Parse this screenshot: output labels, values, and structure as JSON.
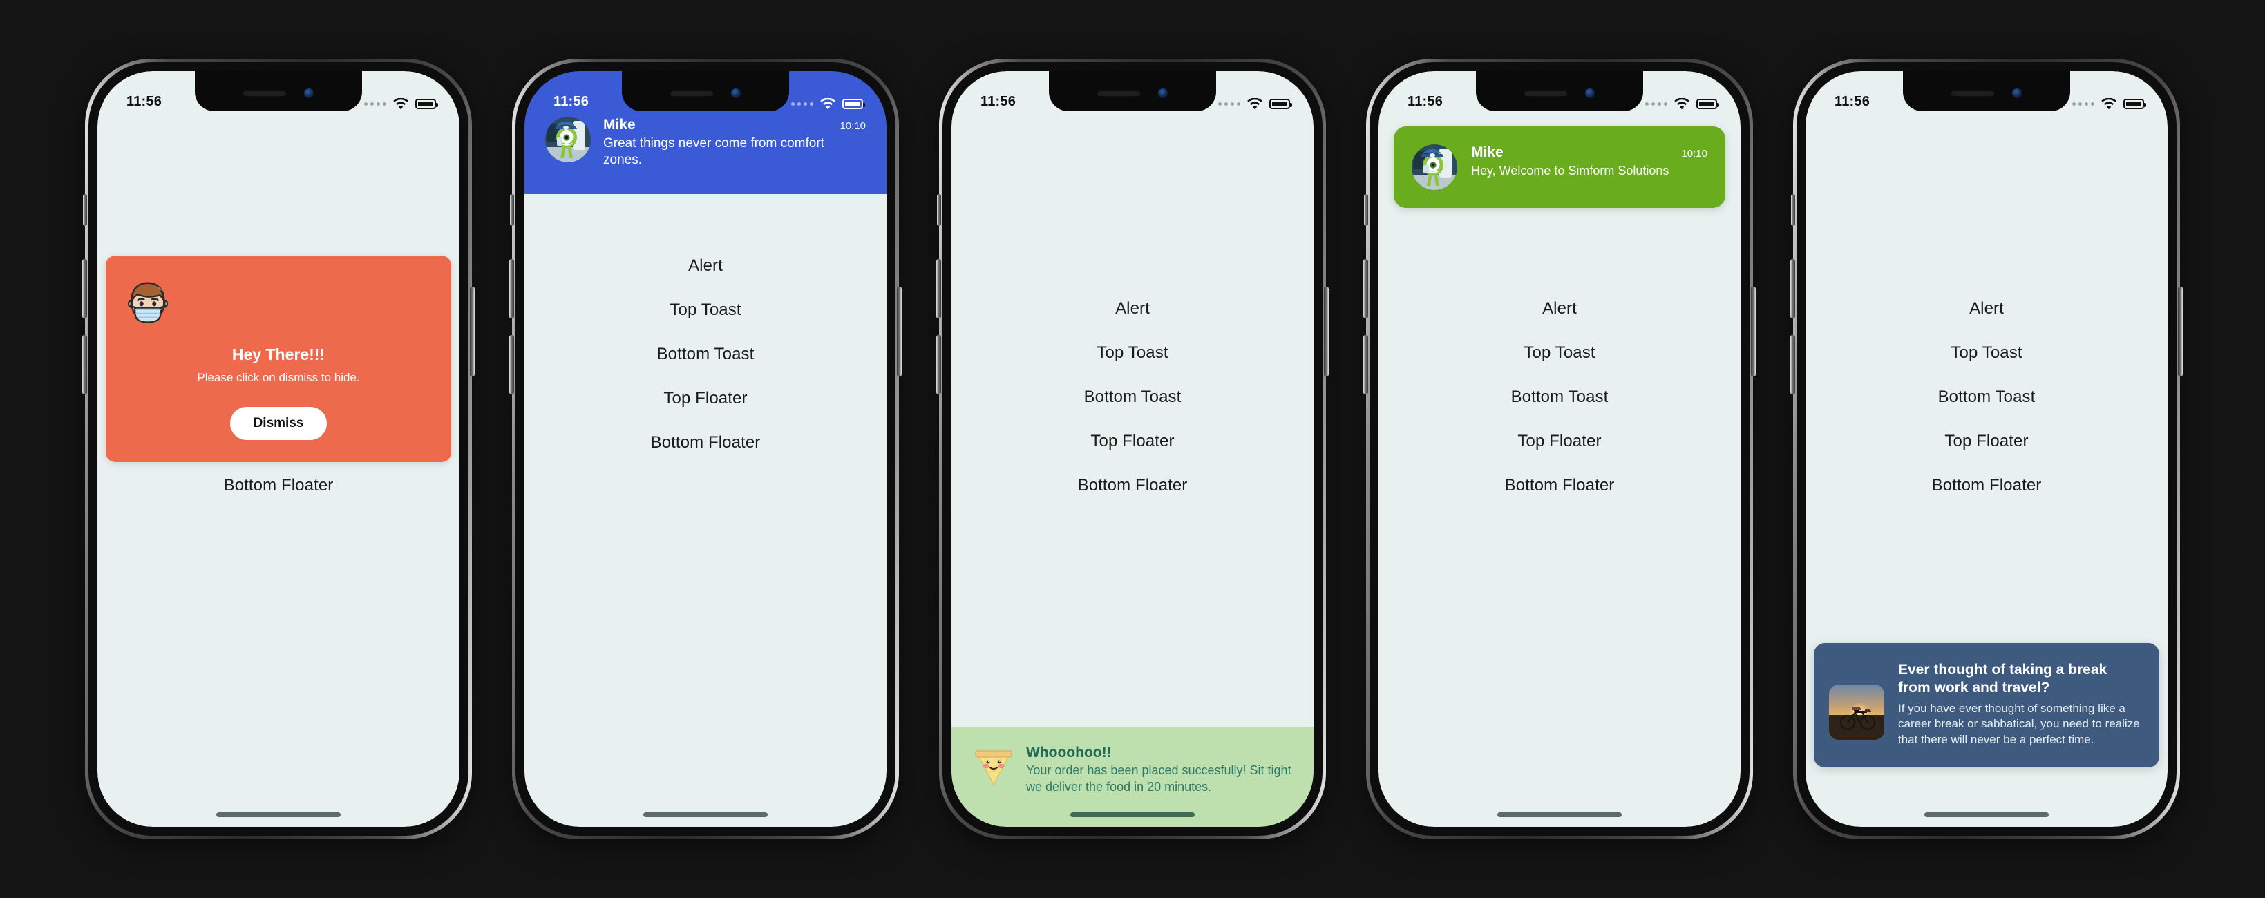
{
  "background_color": "#141414",
  "screen_background": "#e8f1ef",
  "status_bar": {
    "time": "11:56",
    "cellular_icon": "signal-dots-icon",
    "wifi_icon": "wifi-icon",
    "battery_icon": "battery-full-icon"
  },
  "menu_items": [
    {
      "label": "Alert"
    },
    {
      "label": "Top Toast"
    },
    {
      "label": "Bottom Toast"
    },
    {
      "label": "Top Floater"
    },
    {
      "label": "Bottom Floater"
    }
  ],
  "phones": [
    {
      "name": "alert-demo",
      "variant": "alert",
      "alert": {
        "emoji_icon": "man-with-medical-mask-icon",
        "title": "Hey There!!!",
        "subtitle": "Please click on dismiss to hide.",
        "button_label": "Dismiss",
        "card_color": "#ed6a4c",
        "button_color": "#ffffff"
      }
    },
    {
      "name": "top-toast-demo",
      "variant": "top-toast",
      "top_toast": {
        "avatar_icon": "mike-avatar-icon",
        "name": "Mike",
        "time": "10:10",
        "message": "Great things never come from comfort zones.",
        "background_color": "#3b5ad6",
        "text_color": "#ffffff"
      }
    },
    {
      "name": "bottom-toast-demo",
      "variant": "bottom-toast",
      "bottom_toast": {
        "emoji_icon": "pizza-slice-icon",
        "title": "Whooohoo!!",
        "message": "Your order has been placed succesfully! Sit tight we deliver the food in 20 minutes.",
        "background_color": "#bedfae",
        "title_color": "#1f6b58",
        "text_color": "#2d7a67"
      }
    },
    {
      "name": "top-floater-demo",
      "variant": "top-floater",
      "top_floater": {
        "avatar_icon": "mike-avatar-icon",
        "name": "Mike",
        "time": "10:10",
        "message": "Hey, Welcome to Simform Solutions",
        "background_color": "#69ad1f",
        "text_color": "#ffffff"
      }
    },
    {
      "name": "bottom-floater-demo",
      "variant": "bottom-floater",
      "bottom_floater": {
        "thumbnail_icon": "bicycle-sunset-photo-icon",
        "title": "Ever thought of taking a break from work and travel?",
        "message": "If you have ever thought of something like a career break or sabbatical, you need to realize that there will never be a perfect time.",
        "background_color": "#3e5b7f",
        "text_color": "#ffffff"
      }
    }
  ]
}
